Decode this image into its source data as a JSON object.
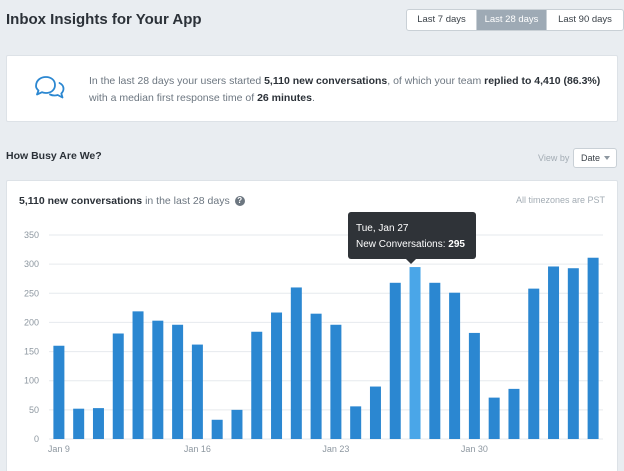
{
  "header": {
    "title": "Inbox Insights for Your App",
    "ranges": [
      {
        "label": "Last 7 days",
        "active": false
      },
      {
        "label": "Last 28 days",
        "active": true
      },
      {
        "label": "Last 90 days",
        "active": false
      }
    ]
  },
  "summary": {
    "icon": "chat-bubbles-icon",
    "part1": "In the last 28 days your users started ",
    "new_conversations": "5,110 new conversations",
    "part2": ", of which your team ",
    "replied": "replied to 4,410 (86.3%)",
    "part3": " with a median first response time of ",
    "response_time": "26 minutes",
    "part4": "."
  },
  "section": {
    "title": "How Busy Are We?",
    "view_by_label": "View by",
    "view_by_value": "Date"
  },
  "chart_header": {
    "count": "5,110 new conversations",
    "suffix": " in the last 28 days",
    "help": "?",
    "timezone_note": "All timezones are PST"
  },
  "tooltip": {
    "date": "Tue, Jan 27",
    "label": "New Conversations: ",
    "value": "295"
  },
  "colors": {
    "bar": "#2b87d1",
    "bar_highlight": "#4aa6e8",
    "active_range": "#9eaab5"
  },
  "chart_data": {
    "type": "bar",
    "x": [
      "Jan 9",
      "Jan 10",
      "Jan 11",
      "Jan 12",
      "Jan 13",
      "Jan 14",
      "Jan 15",
      "Jan 16",
      "Jan 17",
      "Jan 18",
      "Jan 19",
      "Jan 20",
      "Jan 21",
      "Jan 22",
      "Jan 23",
      "Jan 24",
      "Jan 25",
      "Jan 26",
      "Jan 27",
      "Jan 28",
      "Jan 29",
      "Jan 30",
      "Jan 31",
      "Feb 1",
      "Feb 2",
      "Feb 3",
      "Feb 4",
      "Feb 5"
    ],
    "values": [
      160,
      52,
      53,
      181,
      219,
      203,
      196,
      162,
      33,
      50,
      184,
      217,
      260,
      215,
      196,
      56,
      90,
      268,
      295,
      268,
      251,
      182,
      71,
      86,
      258,
      296,
      293,
      311
    ],
    "highlight_index": 18,
    "x_tick_labels": [
      "Jan 9",
      "Jan 16",
      "Jan 23",
      "Jan 30"
    ],
    "x_tick_indices": [
      0,
      7,
      14,
      21
    ],
    "y_ticks": [
      0,
      50,
      100,
      150,
      200,
      250,
      300,
      350
    ],
    "ylim": [
      0,
      350
    ],
    "grid": true
  }
}
